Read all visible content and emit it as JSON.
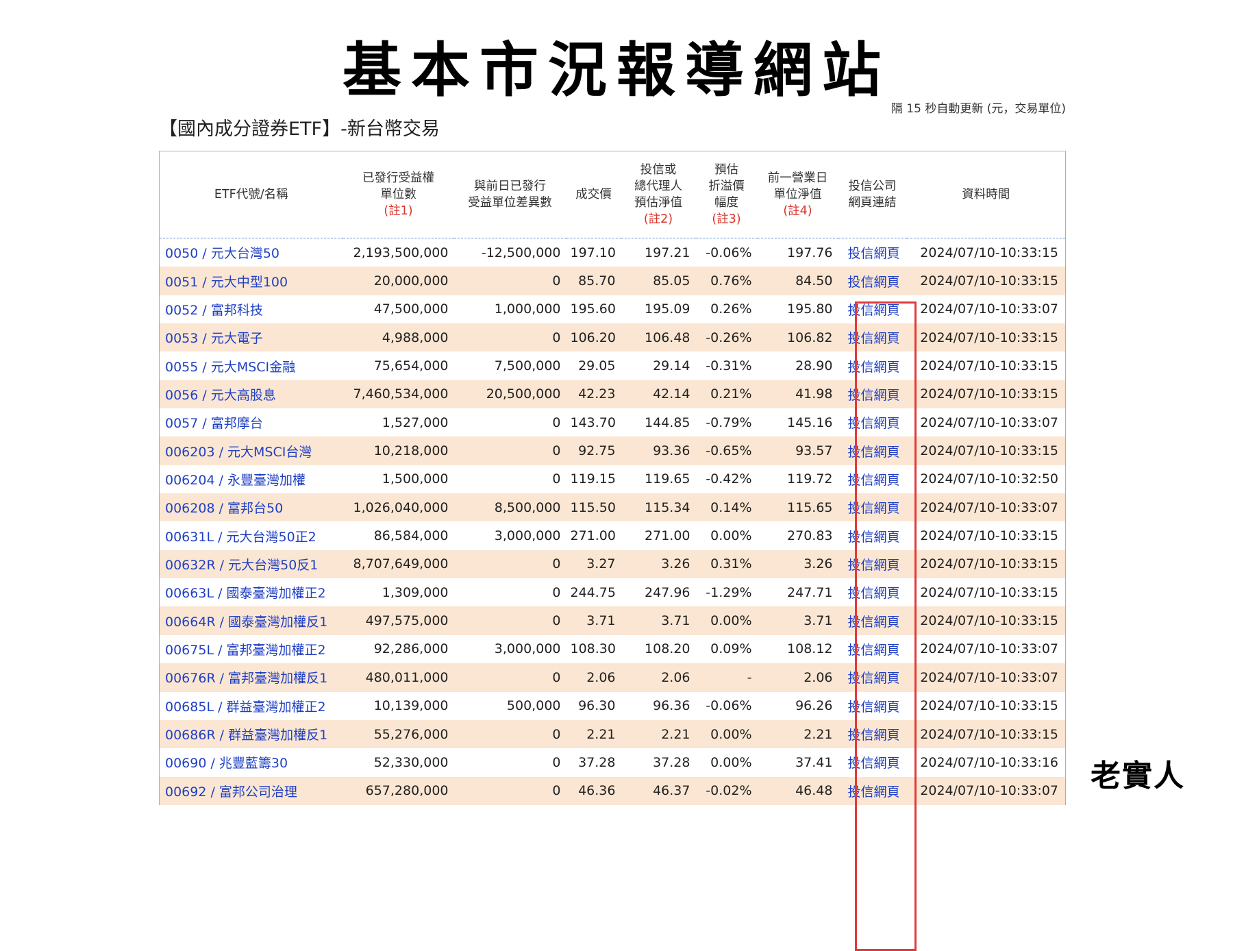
{
  "page_title": "基本市況報導網站",
  "update_note": "隔 15 秒自動更新 (元，交易單位)",
  "section_title": "【國內成分證券ETF】-新台幣交易",
  "watermark": "老實人",
  "colors": {
    "row_alt": "#fae6d2",
    "link": "#1f3fc4",
    "note": "#d9332b",
    "highlight": "#e03a3a"
  },
  "headers": [
    {
      "lines": [
        "ETF代號/名稱"
      ],
      "note": ""
    },
    {
      "lines": [
        "已發行受益權",
        "單位數"
      ],
      "note": "(註1)"
    },
    {
      "lines": [
        "與前日已發行",
        "受益單位差異數"
      ],
      "note": ""
    },
    {
      "lines": [
        "成交價"
      ],
      "note": ""
    },
    {
      "lines": [
        "投信或",
        "總代理人",
        "預估淨值"
      ],
      "note": "(註2)"
    },
    {
      "lines": [
        "預估",
        "折溢價",
        "幅度"
      ],
      "note": "(註3)"
    },
    {
      "lines": [
        "前一營業日",
        "單位淨值"
      ],
      "note": "(註4)"
    },
    {
      "lines": [
        "投信公司",
        "網頁連結"
      ],
      "note": ""
    },
    {
      "lines": [
        "資料時間"
      ],
      "note": ""
    }
  ],
  "rows": [
    {
      "etf": "0050 / 元大台灣50",
      "units": "2,193,500,000",
      "diff": "-12,500,000",
      "price": "197.10",
      "nav_est": "197.21",
      "premium": "-0.06%",
      "prev_nav": "197.76",
      "link": "投信網頁",
      "time": "2024/07/10-10:33:15"
    },
    {
      "etf": "0051 / 元大中型100",
      "units": "20,000,000",
      "diff": "0",
      "price": "85.70",
      "nav_est": "85.05",
      "premium": "0.76%",
      "prev_nav": "84.50",
      "link": "投信網頁",
      "time": "2024/07/10-10:33:15"
    },
    {
      "etf": "0052 / 富邦科技",
      "units": "47,500,000",
      "diff": "1,000,000",
      "price": "195.60",
      "nav_est": "195.09",
      "premium": "0.26%",
      "prev_nav": "195.80",
      "link": "投信網頁",
      "time": "2024/07/10-10:33:07"
    },
    {
      "etf": "0053 / 元大電子",
      "units": "4,988,000",
      "diff": "0",
      "price": "106.20",
      "nav_est": "106.48",
      "premium": "-0.26%",
      "prev_nav": "106.82",
      "link": "投信網頁",
      "time": "2024/07/10-10:33:15"
    },
    {
      "etf": "0055 / 元大MSCI金融",
      "units": "75,654,000",
      "diff": "7,500,000",
      "price": "29.05",
      "nav_est": "29.14",
      "premium": "-0.31%",
      "prev_nav": "28.90",
      "link": "投信網頁",
      "time": "2024/07/10-10:33:15"
    },
    {
      "etf": "0056 / 元大高股息",
      "units": "7,460,534,000",
      "diff": "20,500,000",
      "price": "42.23",
      "nav_est": "42.14",
      "premium": "0.21%",
      "prev_nav": "41.98",
      "link": "投信網頁",
      "time": "2024/07/10-10:33:15"
    },
    {
      "etf": "0057 / 富邦摩台",
      "units": "1,527,000",
      "diff": "0",
      "price": "143.70",
      "nav_est": "144.85",
      "premium": "-0.79%",
      "prev_nav": "145.16",
      "link": "投信網頁",
      "time": "2024/07/10-10:33:07"
    },
    {
      "etf": "006203 / 元大MSCI台灣",
      "units": "10,218,000",
      "diff": "0",
      "price": "92.75",
      "nav_est": "93.36",
      "premium": "-0.65%",
      "prev_nav": "93.57",
      "link": "投信網頁",
      "time": "2024/07/10-10:33:15"
    },
    {
      "etf": "006204 / 永豐臺灣加權",
      "units": "1,500,000",
      "diff": "0",
      "price": "119.15",
      "nav_est": "119.65",
      "premium": "-0.42%",
      "prev_nav": "119.72",
      "link": "投信網頁",
      "time": "2024/07/10-10:32:50"
    },
    {
      "etf": "006208 / 富邦台50",
      "units": "1,026,040,000",
      "diff": "8,500,000",
      "price": "115.50",
      "nav_est": "115.34",
      "premium": "0.14%",
      "prev_nav": "115.65",
      "link": "投信網頁",
      "time": "2024/07/10-10:33:07"
    },
    {
      "etf": "00631L / 元大台灣50正2",
      "units": "86,584,000",
      "diff": "3,000,000",
      "price": "271.00",
      "nav_est": "271.00",
      "premium": "0.00%",
      "prev_nav": "270.83",
      "link": "投信網頁",
      "time": "2024/07/10-10:33:15"
    },
    {
      "etf": "00632R / 元大台灣50反1",
      "units": "8,707,649,000",
      "diff": "0",
      "price": "3.27",
      "nav_est": "3.26",
      "premium": "0.31%",
      "prev_nav": "3.26",
      "link": "投信網頁",
      "time": "2024/07/10-10:33:15"
    },
    {
      "etf": "00663L / 國泰臺灣加權正2",
      "units": "1,309,000",
      "diff": "0",
      "price": "244.75",
      "nav_est": "247.96",
      "premium": "-1.29%",
      "prev_nav": "247.71",
      "link": "投信網頁",
      "time": "2024/07/10-10:33:15"
    },
    {
      "etf": "00664R / 國泰臺灣加權反1",
      "units": "497,575,000",
      "diff": "0",
      "price": "3.71",
      "nav_est": "3.71",
      "premium": "0.00%",
      "prev_nav": "3.71",
      "link": "投信網頁",
      "time": "2024/07/10-10:33:15"
    },
    {
      "etf": "00675L / 富邦臺灣加權正2",
      "units": "92,286,000",
      "diff": "3,000,000",
      "price": "108.30",
      "nav_est": "108.20",
      "premium": "0.09%",
      "prev_nav": "108.12",
      "link": "投信網頁",
      "time": "2024/07/10-10:33:07"
    },
    {
      "etf": "00676R / 富邦臺灣加權反1",
      "units": "480,011,000",
      "diff": "0",
      "price": "2.06",
      "nav_est": "2.06",
      "premium": "-",
      "prev_nav": "2.06",
      "link": "投信網頁",
      "time": "2024/07/10-10:33:07"
    },
    {
      "etf": "00685L / 群益臺灣加權正2",
      "units": "10,139,000",
      "diff": "500,000",
      "price": "96.30",
      "nav_est": "96.36",
      "premium": "-0.06%",
      "prev_nav": "96.26",
      "link": "投信網頁",
      "time": "2024/07/10-10:33:15"
    },
    {
      "etf": "00686R / 群益臺灣加權反1",
      "units": "55,276,000",
      "diff": "0",
      "price": "2.21",
      "nav_est": "2.21",
      "premium": "0.00%",
      "prev_nav": "2.21",
      "link": "投信網頁",
      "time": "2024/07/10-10:33:15"
    },
    {
      "etf": "00690 / 兆豐藍籌30",
      "units": "52,330,000",
      "diff": "0",
      "price": "37.28",
      "nav_est": "37.28",
      "premium": "0.00%",
      "prev_nav": "37.41",
      "link": "投信網頁",
      "time": "2024/07/10-10:33:16"
    },
    {
      "etf": "00692 / 富邦公司治理",
      "units": "657,280,000",
      "diff": "0",
      "price": "46.36",
      "nav_est": "46.37",
      "premium": "-0.02%",
      "prev_nav": "46.48",
      "link": "投信網頁",
      "time": "2024/07/10-10:33:07"
    }
  ]
}
